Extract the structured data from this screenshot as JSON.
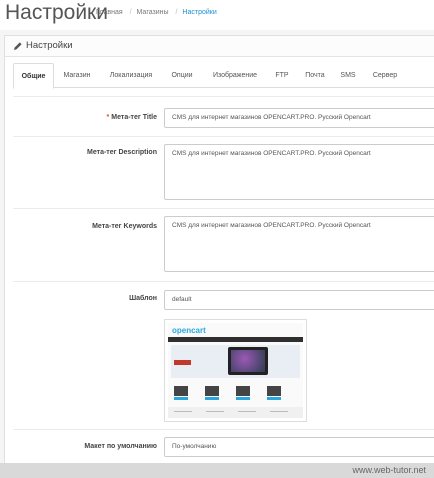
{
  "header": {
    "title": "Настройки",
    "breadcrumb": [
      "Главная",
      "Магазины",
      "Настройки"
    ]
  },
  "panel": {
    "title": "Настройки"
  },
  "tabs": [
    "Общие",
    "Магазин",
    "Локализация",
    "Опции",
    "Изображение",
    "FTP",
    "Почта",
    "SMS",
    "Сервер"
  ],
  "form": {
    "meta_title": {
      "label": "Мета-тег Title",
      "required_mark": "*",
      "value": "CMS для интернет магазинов OPENCART.PRO. Русский Opencart"
    },
    "meta_description": {
      "label": "Мета-тег Description",
      "value": "CMS для интернет магазинов OPENCART.PRO. Русский Opencart"
    },
    "meta_keywords": {
      "label": "Мета-тег Keywords",
      "value": "CMS для интернет магазинов OPENCART.PRO. Русский Opencart"
    },
    "template": {
      "label": "Шаблон",
      "value": "default"
    },
    "default_layout": {
      "label": "Макет по умолчанию",
      "value": "По-умолчанию"
    }
  },
  "preview": {
    "logo_text": "opencart"
  },
  "watermark": "www.web-tutor.net",
  "colors": {
    "accent": "#1e91cf",
    "required": "#e3503e"
  }
}
